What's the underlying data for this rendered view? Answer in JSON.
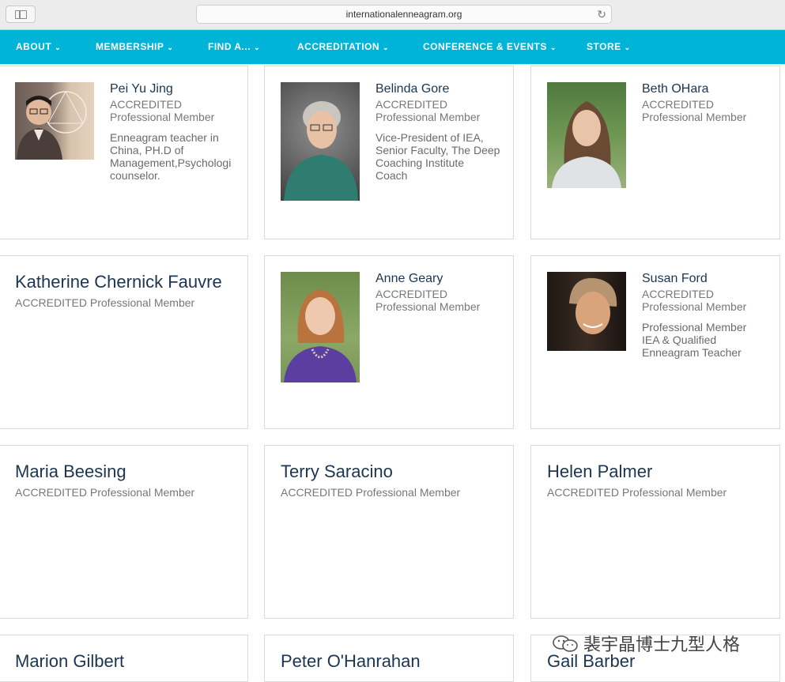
{
  "browser": {
    "url": "internationalenneagram.org"
  },
  "nav": {
    "items": [
      {
        "label": "ABOUT"
      },
      {
        "label": "MEMBERSHIP"
      },
      {
        "label": "FIND A..."
      },
      {
        "label": "ACCREDITATION"
      },
      {
        "label": "CONFERENCE & EVENTS"
      },
      {
        "label": "STORE"
      }
    ],
    "chevron": "⌄"
  },
  "members": [
    {
      "name": "Pei Yu Jing",
      "line1": "ACCREDITED",
      "line2": "Professional Member",
      "bio": [
        "Enneagram teacher in",
        "China, PH.D of",
        "Management,Psychologi",
        "counselor."
      ]
    },
    {
      "name": "Belinda Gore",
      "line1": "ACCREDITED",
      "line2": "Professional Member",
      "bio": [
        "Vice-President of IEA,",
        "Senior Faculty, The Deep",
        "Coaching Institute",
        "Coach"
      ]
    },
    {
      "name": "Beth OHara",
      "line1": "ACCREDITED",
      "line2": "Professional Member"
    },
    {
      "name": "Katherine Chernick Fauvre",
      "sub": "ACCREDITED Professional Member"
    },
    {
      "name": "Anne Geary",
      "line1": "ACCREDITED",
      "line2": "Professional Member"
    },
    {
      "name": "Susan Ford",
      "line1": "ACCREDITED",
      "line2": "Professional Member",
      "bio": [
        "Professional Member",
        "IEA & Qualified",
        "Enneagram Teacher"
      ]
    },
    {
      "name": "Maria Beesing",
      "sub": "ACCREDITED Professional Member"
    },
    {
      "name": "Terry Saracino",
      "sub": "ACCREDITED Professional Member"
    },
    {
      "name": "Helen Palmer",
      "sub": "ACCREDITED Professional Member"
    },
    {
      "name": "Marion Gilbert"
    },
    {
      "name": "Peter O'Hanrahan"
    },
    {
      "name": "Gail Barber"
    }
  ],
  "watermark": {
    "text": "裴宇晶博士九型人格"
  },
  "colors": {
    "nav": "#00b4d8",
    "name": "#1c3550",
    "meta": "#777777"
  }
}
